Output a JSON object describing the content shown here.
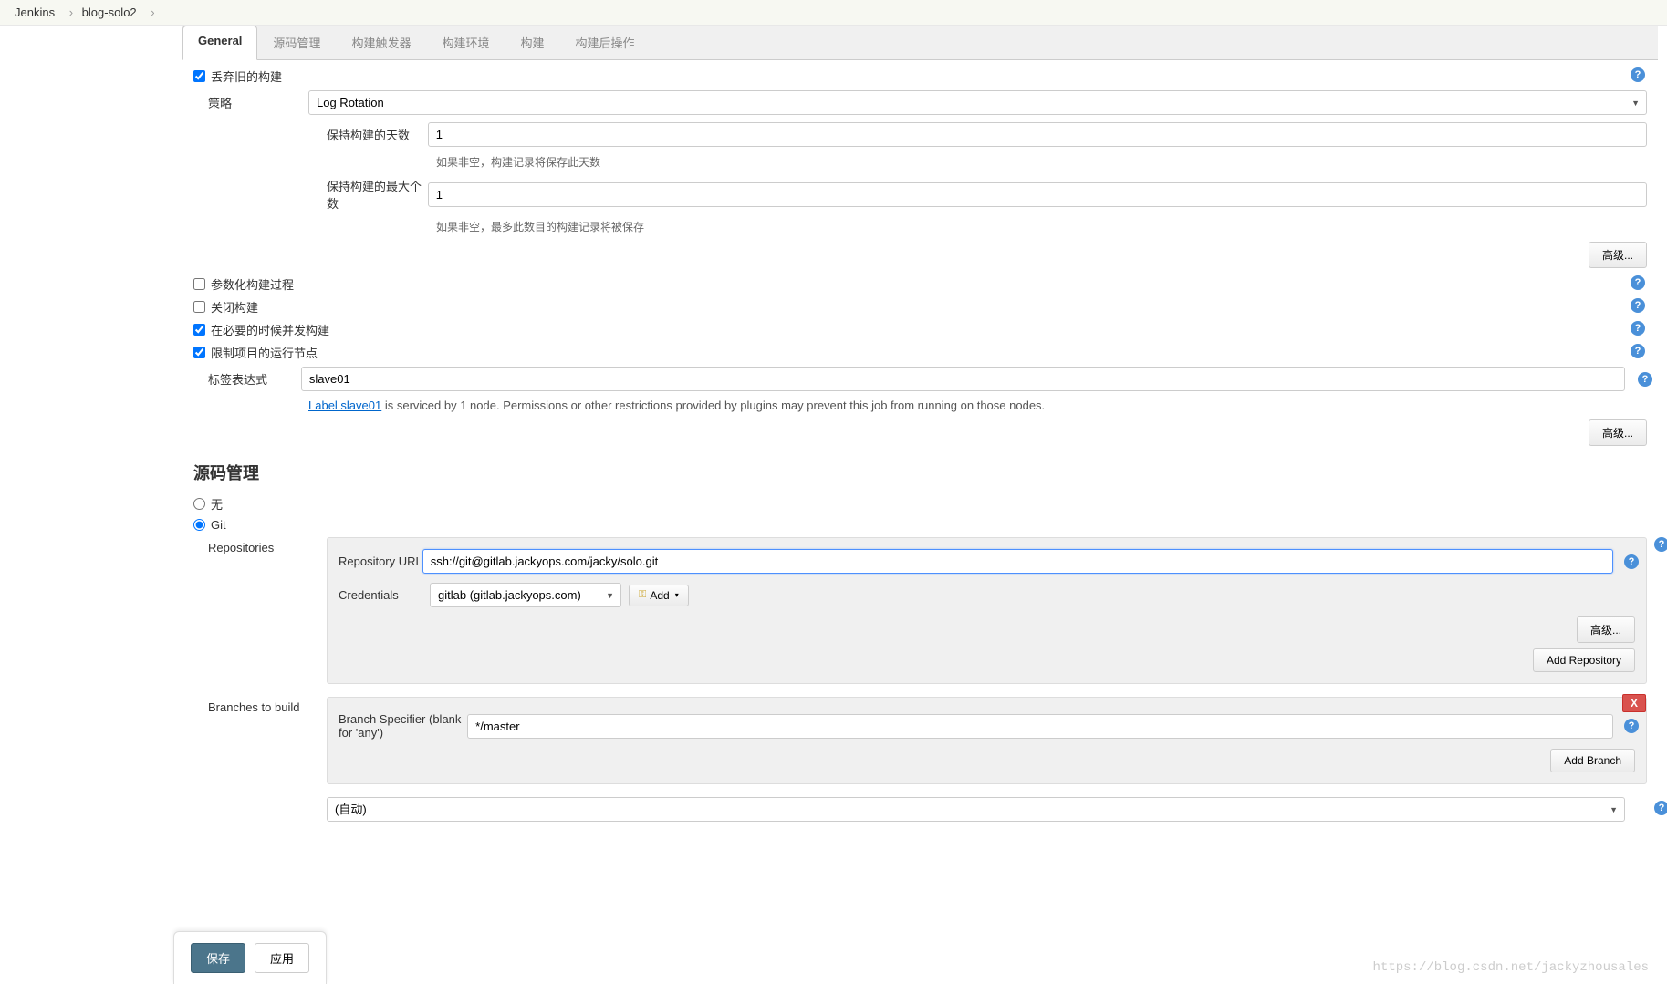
{
  "breadcrumb": {
    "jenkins": "Jenkins",
    "project": "blog-solo2"
  },
  "tabs": {
    "general": "General",
    "scm": "源码管理",
    "triggers": "构建触发器",
    "env": "构建环境",
    "build": "构建",
    "post": "构建后操作"
  },
  "general": {
    "discard_old": {
      "label": "丢弃旧的构建",
      "checked": true
    },
    "strategy": {
      "label": "策略",
      "value": "Log Rotation"
    },
    "days_to_keep": {
      "label": "保持构建的天数",
      "value": "1",
      "help": "如果非空，构建记录将保存此天数"
    },
    "max_to_keep": {
      "label": "保持构建的最大个数",
      "value": "1",
      "help": "如果非空，最多此数目的构建记录将被保存"
    },
    "advanced_btn": "高级...",
    "parameterized": {
      "label": "参数化构建过程",
      "checked": false
    },
    "disable_build": {
      "label": "关闭构建",
      "checked": false
    },
    "concurrent": {
      "label": "在必要的时候并发构建",
      "checked": true
    },
    "restrict_node": {
      "label": "限制项目的运行节点",
      "checked": true
    },
    "label_expr": {
      "label": "标签表达式",
      "value": "slave01"
    },
    "label_note": {
      "link_text": "Label slave01",
      "rest": " is serviced by 1 node. Permissions or other restrictions provided by plugins may prevent this job from running on those nodes."
    }
  },
  "scm": {
    "title": "源码管理",
    "none": "无",
    "git": "Git",
    "repositories_label": "Repositories",
    "repo_url_label": "Repository URL",
    "repo_url_value": "ssh://git@gitlab.jackyops.com/jacky/solo.git",
    "credentials_label": "Credentials",
    "credentials_value": "gitlab (gitlab.jackyops.com)",
    "add_btn": "Add",
    "repo_advanced": "高级...",
    "add_repo_btn": "Add Repository",
    "branches_label": "Branches to build",
    "branch_spec_label": "Branch Specifier (blank for 'any')",
    "branch_spec_value": "*/master",
    "delete_btn": "X",
    "add_branch_btn": "Add Branch",
    "auto_value": "(自动)"
  },
  "buttons": {
    "save": "保存",
    "apply": "应用"
  },
  "watermark": "https://blog.csdn.net/jackyzhousales"
}
